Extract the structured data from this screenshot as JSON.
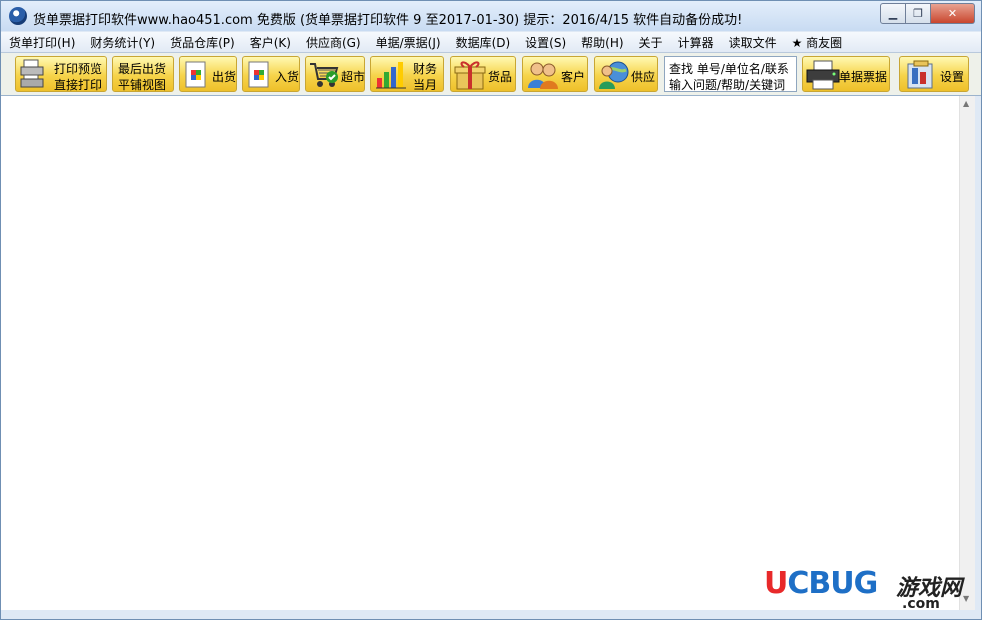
{
  "window": {
    "title": "货单票据打印软件www.hao451.com 免费版 (货单票据打印软件  9 至2017-01-30)  提示：2016/4/15 软件自动备份成功!"
  },
  "menu": [
    {
      "label": "货单打印(H)"
    },
    {
      "label": "财务统计(Y)"
    },
    {
      "label": "货品仓库(P)"
    },
    {
      "label": "客户(K)"
    },
    {
      "label": "供应商(G)"
    },
    {
      "label": "单据/票据(J)"
    },
    {
      "label": "数据库(D)"
    },
    {
      "label": "设置(S)"
    },
    {
      "label": "帮助(H)"
    },
    {
      "label": "关于"
    },
    {
      "label": "计算器"
    },
    {
      "label": "读取文件"
    },
    {
      "label": "★ 商友圈"
    }
  ],
  "toolbar": {
    "print_preview": "打印预览",
    "direct_print": "直接打印",
    "last_shipment": "最后出货",
    "tile_view": "平铺视图",
    "ship_out": "出货",
    "stock_in": "入货",
    "supermarket": "超市",
    "finance_line1": "财务",
    "finance_line2": "当月",
    "goods": "货品",
    "customer": "客户",
    "supplier": "供应",
    "search_line1": "查找 单号/单位名/联系",
    "search_line2": "输入问题/帮助/关键词",
    "documents": "单据票据",
    "settings": "设置"
  },
  "watermark": {
    "brand": "UCBUG",
    "cn": "游戏网",
    "suffix": ".com",
    "colors": {
      "u": "#e8292a",
      "c": "#1e6fc6",
      "bug": "#1e6fc6"
    }
  }
}
